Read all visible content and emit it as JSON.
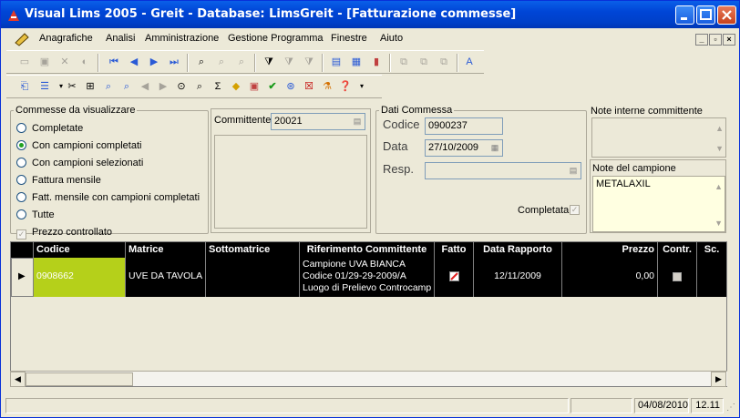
{
  "window": {
    "title": "Visual Lims 2005 - Greit - Database: LimsGreit - [Fatturazione commesse]"
  },
  "menu": [
    "Anagrafiche",
    "Analisi",
    "Amministrazione",
    "Gestione Programma",
    "Finestre",
    "Aiuto"
  ],
  "filter": {
    "legend": "Commesse da visualizzare",
    "options": [
      "Completate",
      "Con campioni completati",
      "Con campioni selezionati",
      "Fattura mensile",
      "Fatt. mensile con campioni completati",
      "Tutte"
    ],
    "selected": "Con campioni completati",
    "price_check_label": "Prezzo controllato",
    "price_checked": true
  },
  "committente": {
    "label": "Committente",
    "value": "20021"
  },
  "dati": {
    "legend": "Dati Commessa",
    "codice_label": "Codice",
    "codice": "0900237",
    "data_label": "Data",
    "data": "27/10/2009",
    "resp_label": "Resp.",
    "resp": "",
    "completata_label": "Completata",
    "completata": true
  },
  "note_interne": {
    "label": "Note interne committente",
    "value": ""
  },
  "note_campione": {
    "label": "Note del campione",
    "value": "METALAXIL"
  },
  "grid": {
    "headers": [
      "Codice",
      "Matrice",
      "Sottomatrice",
      "Riferimento Committente",
      "Fatto",
      "Data Rapporto",
      "Prezzo",
      "Contr.",
      "Sc."
    ],
    "rows": [
      {
        "codice": "0908662",
        "matrice": "UVE DA TAVOLA",
        "sottomatrice": "",
        "rif1": "Campione UVA BIANCA",
        "rif2": "Codice 01/29-29-2009/A",
        "rif3": "Luogo di Prelievo Controcamp",
        "fatto": true,
        "data_rapporto": "12/11/2009",
        "prezzo": "0,00",
        "contr": false,
        "sc": ""
      }
    ]
  },
  "status": {
    "date": "04/08/2010",
    "time": "12.11"
  },
  "colors": {
    "title_bar": "#0045d6",
    "grid_bg": "#000000",
    "highlight_cell": "#b5d01a"
  }
}
